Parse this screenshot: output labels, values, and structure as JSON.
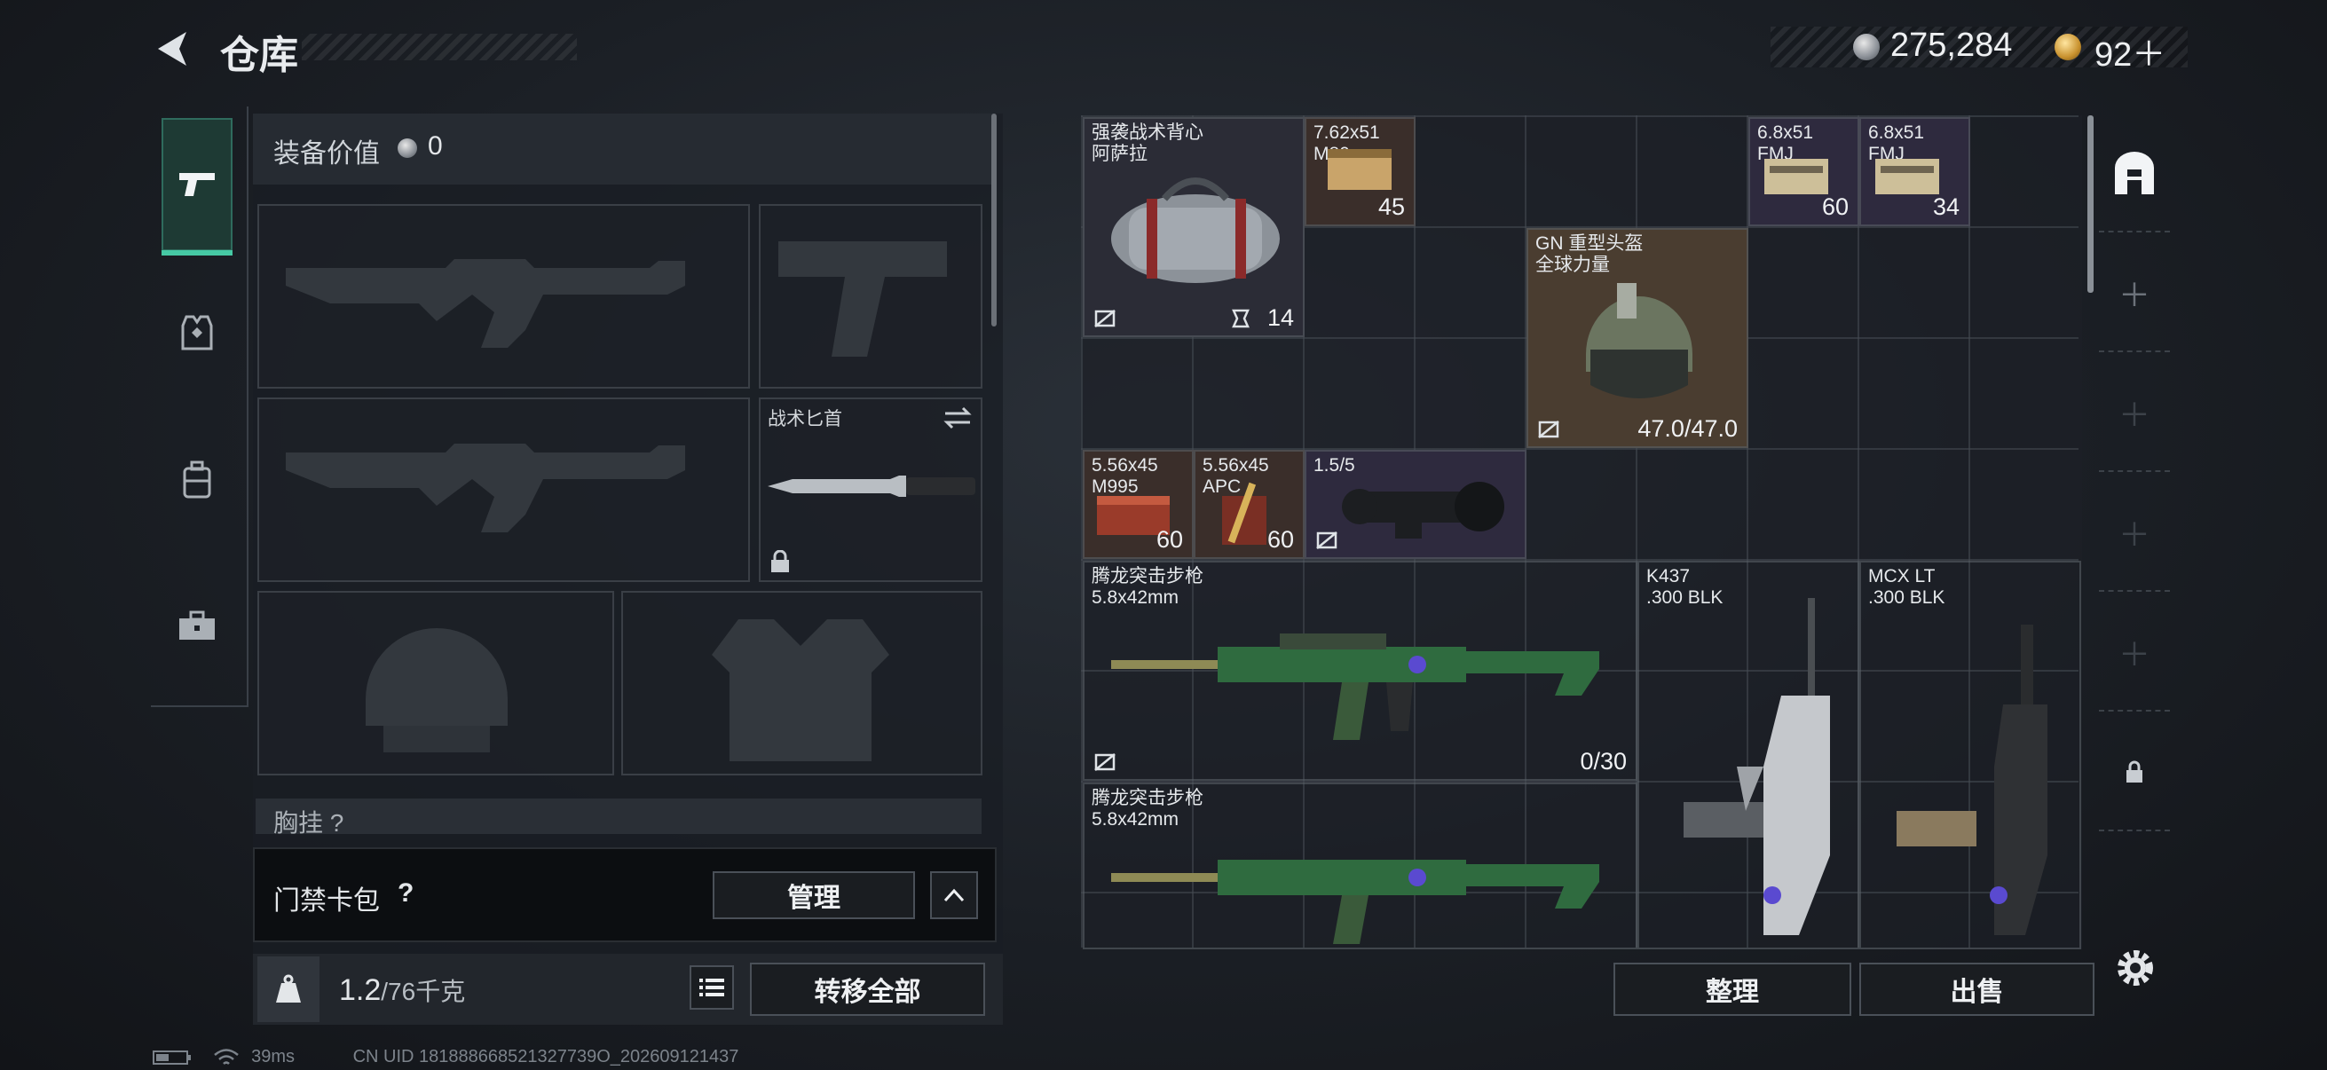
{
  "header": {
    "title": "仓库",
    "currency": [
      {
        "icon": "silver-coin-icon",
        "amount": "275,284"
      },
      {
        "icon": "gold-coin-icon",
        "amount": "92＋"
      }
    ]
  },
  "tabs": [
    {
      "icon": "pistol-icon",
      "active": true
    },
    {
      "icon": "vest-icon",
      "active": false
    },
    {
      "icon": "backpack-icon",
      "active": false
    },
    {
      "icon": "toolbox-icon",
      "active": false
    }
  ],
  "loadout": {
    "value_label": "装备价值",
    "value": "0",
    "knife_slot_label": "战术匕首",
    "chest_label": "胸挂 ?",
    "card_pack_label": "门禁卡包",
    "card_help": "?",
    "manage_button": "管理",
    "weight": "1.2",
    "weight_capacity": "/76千克",
    "transfer_all_button": "转移全部"
  },
  "stash": {
    "items": [
      {
        "name": "强袭战术背心\n阿萨拉",
        "qty": "14",
        "icon": "duffel-bag-icon"
      },
      {
        "name": "7.62x51\nM80",
        "qty": "45",
        "icon": "ammo-box-icon"
      },
      {
        "name": "6.8x51\nFMJ",
        "qty": "60",
        "icon": "ammo-box-icon"
      },
      {
        "name": "6.8x51\nFMJ",
        "qty": "34",
        "icon": "ammo-box-icon"
      },
      {
        "name": "GN 重型头盔\n全球力量",
        "qty": "47.0/47.0",
        "icon": "helmet-icon"
      },
      {
        "name": "5.56x45\nM995",
        "qty": "60",
        "icon": "ammo-box-icon"
      },
      {
        "name": "5.56x45\nAPC",
        "qty": "60",
        "icon": "ammo-box-icon"
      },
      {
        "name": "1.5/5",
        "qty": "",
        "icon": "scope-icon"
      },
      {
        "name": "腾龙突击步枪\n5.8x42mm",
        "qty": "0/30",
        "icon": "rifle-icon"
      },
      {
        "name": "K437\n.300 BLK",
        "qty": "",
        "icon": "rifle-icon"
      },
      {
        "name": "MCX LT\n.300 BLK",
        "qty": "",
        "icon": "rifle-icon"
      },
      {
        "name": "腾龙突击步枪\n5.8x42mm",
        "qty": "",
        "icon": "rifle-icon"
      }
    ],
    "sort_button": "整理",
    "sell_button": "出售"
  },
  "status": {
    "ping": "39ms",
    "uid": "CN UID 181888668521327739O_202609121437"
  },
  "colors": {
    "accent": "#46c9a4",
    "rare_slot": "#3a2e2a",
    "helmet_slot": "#5a4a3a",
    "epic_slot": "#2e2a3e"
  }
}
